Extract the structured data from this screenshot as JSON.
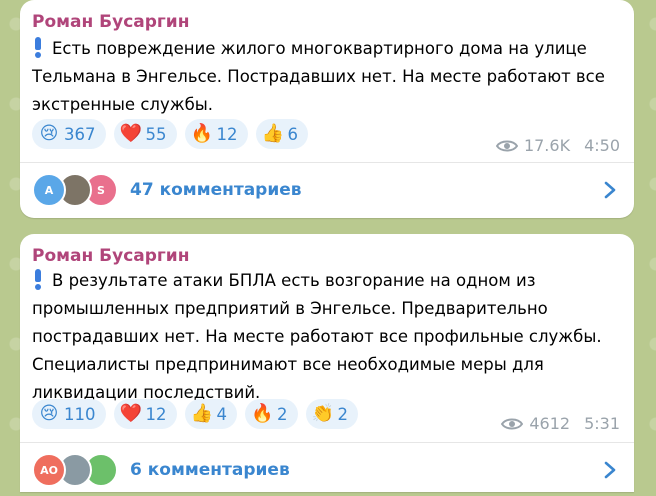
{
  "posts": [
    {
      "author": "Роман Бусаргин",
      "text": "Есть повреждение жилого многоквартирного дома на улице Тельмана в Энгельсе. Пострадавших нет. На месте работают все экстренные службы.",
      "reactions": [
        {
          "emoji": "😢",
          "icon": "crying-face-icon",
          "count": "367"
        },
        {
          "emoji": "❤️",
          "icon": "heart-icon",
          "count": "55"
        },
        {
          "emoji": "🔥",
          "icon": "fire-icon",
          "count": "12"
        },
        {
          "emoji": "👍",
          "icon": "thumbs-up-icon",
          "count": "6"
        }
      ],
      "views": "17.6K",
      "time": "4:50",
      "avatars": [
        {
          "initial": "A",
          "color": "#5aa7e8"
        },
        {
          "initial": "",
          "color": "#7d7466"
        },
        {
          "initial": "S",
          "color": "#e9708d"
        }
      ],
      "comments_label": "47 комментариев"
    },
    {
      "author": "Роман Бусаргин",
      "text": "В результате атаки БПЛА есть возгорание на одном из промышленных предприятий в Энгельсе. Предварительно пострадавших нет. На месте работают все профильные службы. Специалисты предпринимают все необходимые меры для ликвидации последствий.",
      "reactions": [
        {
          "emoji": "😢",
          "icon": "crying-face-icon",
          "count": "110"
        },
        {
          "emoji": "❤️",
          "icon": "heart-icon",
          "count": "12"
        },
        {
          "emoji": "👍",
          "icon": "thumbs-up-icon",
          "count": "4"
        },
        {
          "emoji": "🔥",
          "icon": "fire-icon",
          "count": "2"
        },
        {
          "emoji": "👏",
          "icon": "clapping-hands-icon",
          "count": "2"
        }
      ],
      "views": "4612",
      "time": "5:31",
      "avatars": [
        {
          "initial": "AO",
          "color": "#ef6e5e"
        },
        {
          "initial": "",
          "color": "#8a9aa3"
        },
        {
          "initial": "",
          "color": "#6cc06a"
        }
      ],
      "comments_label": "6 комментариев"
    }
  ]
}
